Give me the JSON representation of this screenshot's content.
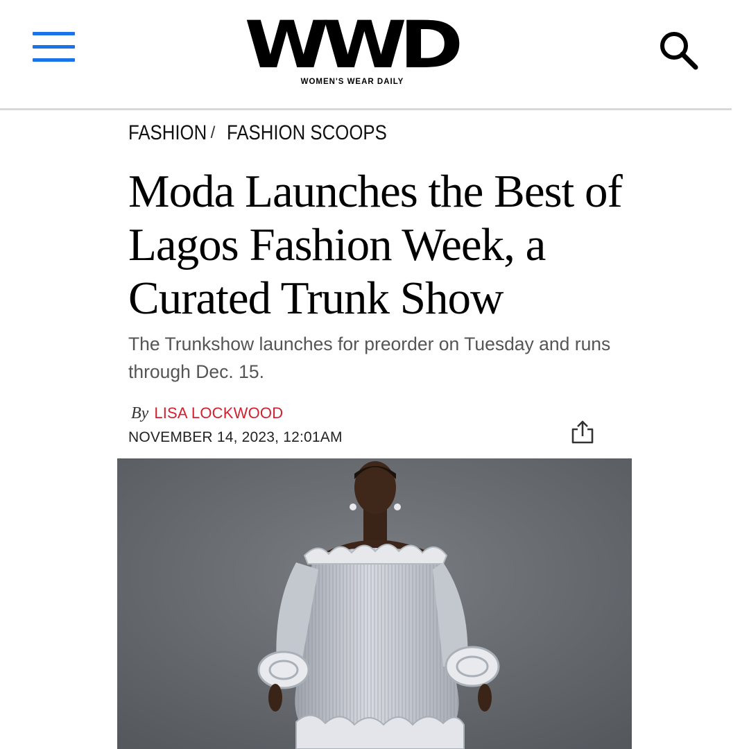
{
  "header": {
    "logo_mark": "WWD",
    "logo_tagline": "WOMEN'S WEAR DAILY",
    "menu_icon": "hamburger-menu-icon",
    "search_icon": "search-icon",
    "menu_color": "#1a73e8"
  },
  "breadcrumb": {
    "items": [
      "FASHION",
      "FASHION SCOOPS"
    ],
    "separator": "/"
  },
  "article": {
    "headline": "Moda Launches the Best of Lagos Fashion Week, a Curated Trunk Show",
    "dek": "The Trunkshow launches for preorder on Tuesday and runs through Dec. 15.",
    "by_label": "By",
    "author": "LISA LOCKWOOD",
    "author_color": "#d2202f",
    "date": "NOVEMBER 14, 2023, 12:01AM",
    "share_icon": "share-icon"
  },
  "hero_image": {
    "subject": "runway-model-photo"
  }
}
